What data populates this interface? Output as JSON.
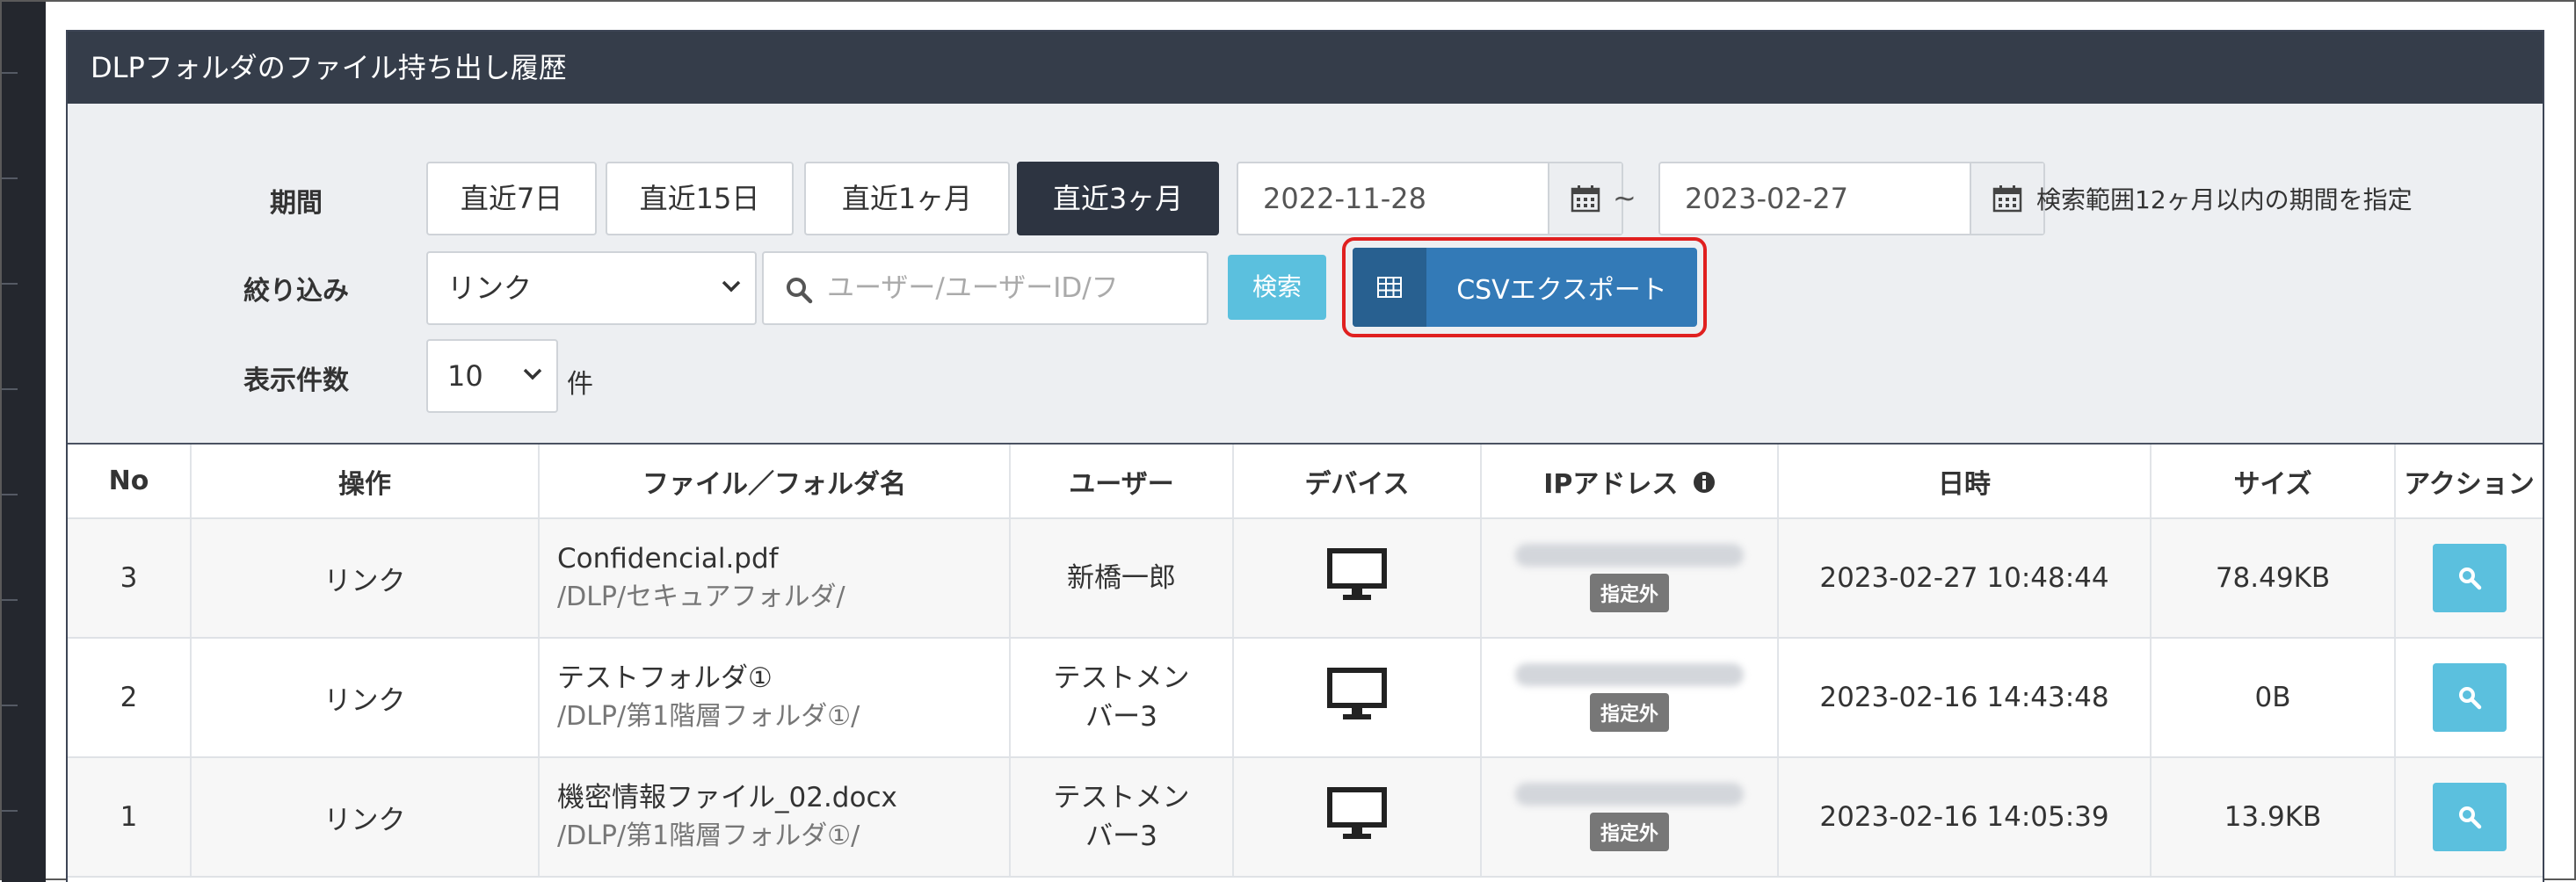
{
  "panel": {
    "title": "DLPフォルダのファイル持ち出し履歴"
  },
  "filters": {
    "period_label": "期間",
    "narrow_label": "絞り込み",
    "count_label": "表示件数",
    "period_buttons": [
      {
        "label": "直近7日",
        "active": false
      },
      {
        "label": "直近15日",
        "active": false
      },
      {
        "label": "直近1ヶ月",
        "active": false
      },
      {
        "label": "直近3ヶ月",
        "active": true
      }
    ],
    "date_from": "2022-11-28",
    "date_to": "2023-02-27",
    "tilde": "~",
    "range_note": "検索範囲12ヶ月以内の期間を指定",
    "operation_select": "リンク",
    "search_placeholder": "ユーザー/ユーザーID/フ",
    "search_button": "検索",
    "csv_button": "CSVエクスポート",
    "count_select": "10",
    "count_unit": "件"
  },
  "table": {
    "headers": [
      "No",
      "操作",
      "ファイル／フォルダ名",
      "ユーザー",
      "デバイス",
      "IPアドレス",
      "日時",
      "サイズ",
      "アクション"
    ],
    "rows": [
      {
        "no": "3",
        "operation": "リンク",
        "file": "Confidencial.pdf",
        "path": "/DLP/セキュアフォルダ/",
        "user_line1": "新橋一郎",
        "user_line2": "",
        "ip_badge": "指定外",
        "datetime": "2023-02-27 10:48:44",
        "size": "78.49KB"
      },
      {
        "no": "2",
        "operation": "リンク",
        "file": "テストフォルダ①",
        "path": "/DLP/第1階層フォルダ①/",
        "user_line1": "テストメン",
        "user_line2": "バー3",
        "ip_badge": "指定外",
        "datetime": "2023-02-16 14:43:48",
        "size": "0B"
      },
      {
        "no": "1",
        "operation": "リンク",
        "file": "機密情報ファイル_02.docx",
        "path": "/DLP/第1階層フォルダ①/",
        "user_line1": "テストメン",
        "user_line2": "バー3",
        "ip_badge": "指定外",
        "datetime": "2023-02-16 14:05:39",
        "size": "13.9KB"
      }
    ]
  },
  "icons": {
    "calendar": "calendar-icon",
    "search": "search-icon",
    "table": "table-icon",
    "monitor": "monitor-icon",
    "info": "info-icon"
  },
  "colors": {
    "header_bg": "#353d4a",
    "active_button": "#2d3441",
    "csv_button": "#337ab7",
    "search_button": "#5bc0de",
    "highlight": "#e02020",
    "badge": "#777777"
  }
}
